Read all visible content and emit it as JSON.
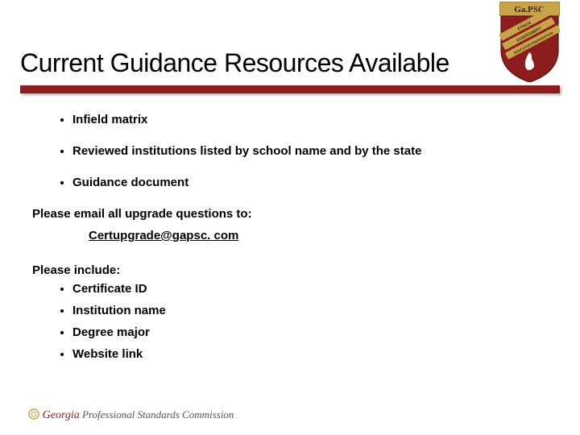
{
  "logo": {
    "top_label": "Ga.PSC",
    "band1": "ETHICS",
    "band2": "ASSESSMENT",
    "band3": "EDUCATOR PREPARATION"
  },
  "title": "Current Guidance Resources Available",
  "bullets1": [
    "Infield matrix",
    "Reviewed institutions listed by school name and by the state",
    "Guidance document"
  ],
  "email_prompt": "Please email all upgrade questions to:",
  "email": "Certupgrade@gapsc. com",
  "include_prompt": "Please include:",
  "bullets2": [
    "Certificate ID",
    "Institution name",
    "Degree major",
    "Website link"
  ],
  "footer": {
    "org_prefix": "Georgia",
    "org_rest": " Professional Standards Commission"
  }
}
